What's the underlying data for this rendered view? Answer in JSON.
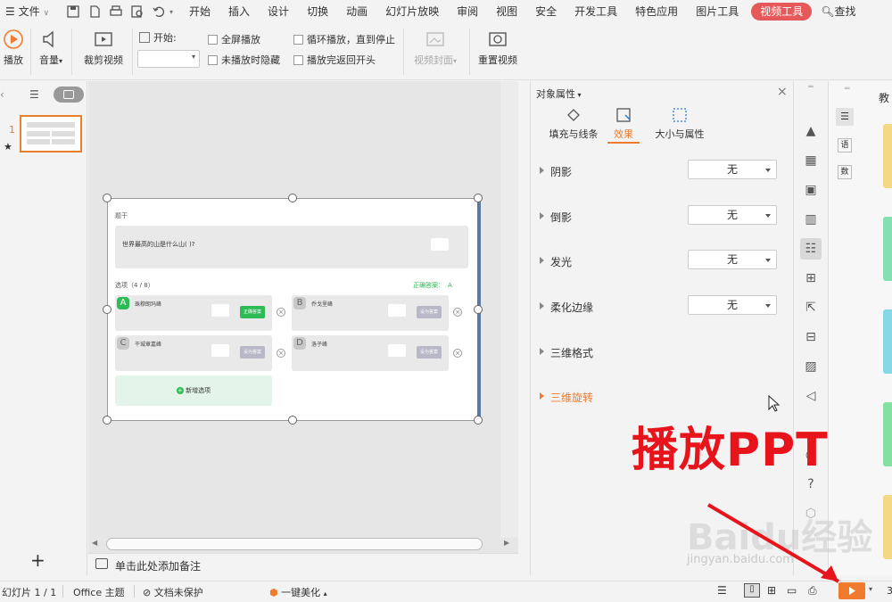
{
  "menu": {
    "file": "文件",
    "tabs": [
      "开始",
      "插入",
      "设计",
      "切换",
      "动画",
      "幻灯片放映",
      "审阅",
      "视图",
      "安全",
      "开发工具",
      "特色应用",
      "图片工具",
      "视频工具"
    ],
    "search": "查找"
  },
  "ribbon": {
    "play": "播放",
    "volume": "音量",
    "trim": "裁剪视频",
    "start_label": "开始:",
    "fullscreen": "全屏播放",
    "hide_not_playing": "未播放时隐藏",
    "loop": "循环播放，直到停止",
    "rewind": "播放完返回开头",
    "cover": "视频封面",
    "reset": "重置视频"
  },
  "slides": {
    "number": "1"
  },
  "slide": {
    "header": "题干",
    "question": "世界最高的山是什么山( )?",
    "options_label": "选项（4 / 8）",
    "correct_label": "正确答案：",
    "correct_value": "A",
    "options": [
      {
        "letter": "A",
        "text": "珠穆朗玛峰",
        "btn": "正确答案"
      },
      {
        "letter": "B",
        "text": "乔戈里峰",
        "btn": "设为答案"
      },
      {
        "letter": "C",
        "text": "干城章嘉峰",
        "btn": "设为答案"
      },
      {
        "letter": "D",
        "text": "洛子峰",
        "btn": "设为答案"
      }
    ],
    "add": "新增选项"
  },
  "notes": "单击此处添加备注",
  "props": {
    "title": "对象属性",
    "tabs": [
      "填充与线条",
      "效果",
      "大小与属性"
    ],
    "rows": [
      {
        "label": "阴影",
        "value": "无"
      },
      {
        "label": "倒影",
        "value": "无"
      },
      {
        "label": "发光",
        "value": "无"
      },
      {
        "label": "柔化边缘",
        "value": "无"
      },
      {
        "label": "三维格式",
        "value": ""
      },
      {
        "label": "三维旋转",
        "value": ""
      }
    ]
  },
  "far": {
    "title": "教",
    "items": [
      "语",
      "数"
    ]
  },
  "status": {
    "slide": "幻灯片 1 / 1",
    "theme": "Office 主题",
    "protect": "文档未保护",
    "beautify": "一键美化",
    "zoom": "3"
  },
  "overlay": "播放PPT",
  "watermark": {
    "text": "Baidu经验",
    "url": "jingyan.baidu.com"
  },
  "colors": {
    "accent": "#e6595b",
    "green": "#2dbb55",
    "orange": "#f07a2e",
    "red": "#e8141b"
  }
}
